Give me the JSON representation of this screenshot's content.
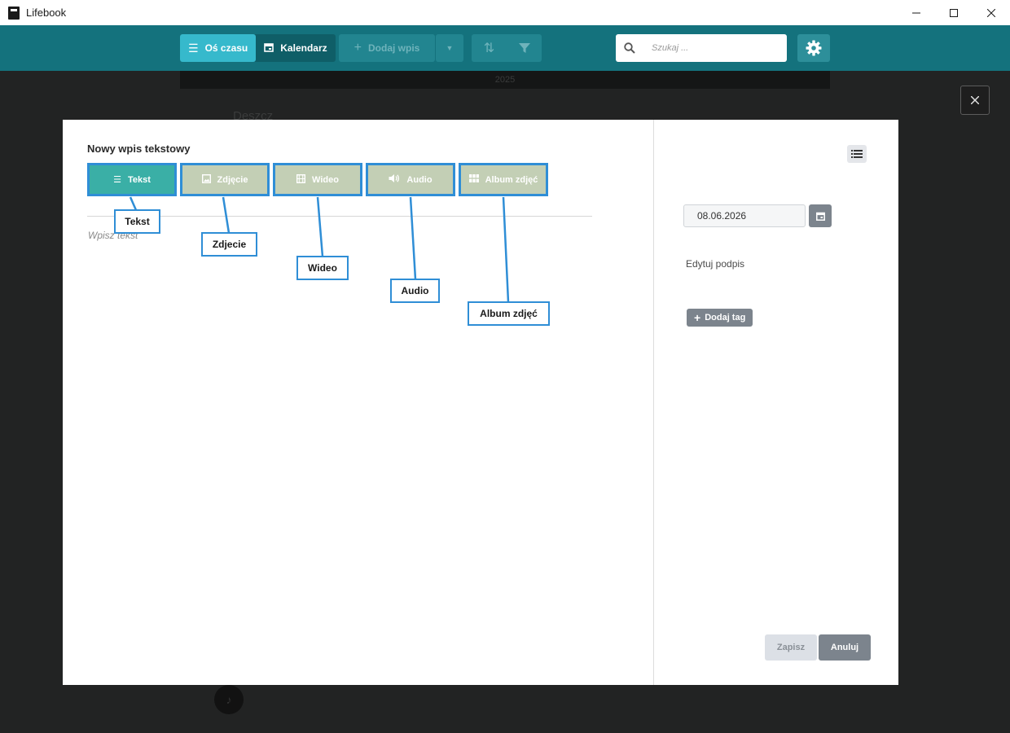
{
  "window": {
    "title": "Lifebook",
    "minimize_icon": "minimize-icon",
    "maximize_icon": "maximize-icon",
    "close_icon": "close-icon"
  },
  "toolbar": {
    "timeline_label": "Oś czasu",
    "calendar_label": "Kalendarz",
    "add_entry_label": "Dodaj wpis",
    "search_placeholder": "Szukaj ...",
    "accent_color": "#14727d",
    "active_color": "#36b9cc"
  },
  "background": {
    "year_label": "2025",
    "entry_title": "Deszcz"
  },
  "modal": {
    "title": "Nowy wpis tekstowy",
    "text_placeholder": "Wpisz tekst",
    "tabs": [
      {
        "label": "Tekst",
        "icon": "text-lines-icon",
        "active": true
      },
      {
        "label": "Zdjęcie",
        "icon": "image-icon",
        "active": false
      },
      {
        "label": "Wideo",
        "icon": "film-icon",
        "active": false
      },
      {
        "label": "Audio",
        "icon": "speaker-icon",
        "active": false
      },
      {
        "label": "Album zdjęć",
        "icon": "grid-icon",
        "active": false
      }
    ],
    "date_value": "08.06.2026",
    "edit_caption": "Edytuj podpis",
    "add_tag_label": "Dodaj tag",
    "save_label": "Zapisz",
    "cancel_label": "Anuluj"
  },
  "annotations": [
    "Tekst",
    "Zdjecie",
    "Wideo",
    "Audio",
    "Album zdjęć"
  ]
}
